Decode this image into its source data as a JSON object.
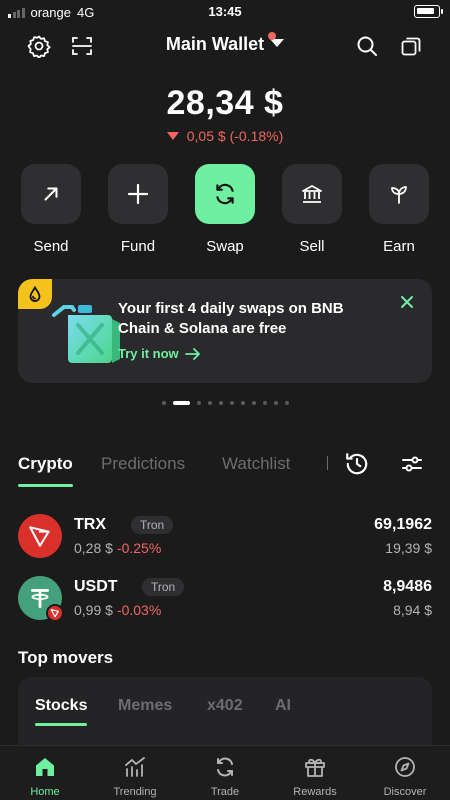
{
  "status_bar": {
    "carrier": "orange",
    "network": "4G",
    "time": "13:45"
  },
  "header": {
    "title": "Main Wallet"
  },
  "balance": {
    "amount": "28,34 $",
    "change": "0,05 $ (-0.18%)"
  },
  "actions": [
    {
      "label": "Send",
      "icon": "arrow-up-right-icon"
    },
    {
      "label": "Fund",
      "icon": "plus-icon"
    },
    {
      "label": "Swap",
      "icon": "swap-icon"
    },
    {
      "label": "Sell",
      "icon": "bank-icon"
    },
    {
      "label": "Earn",
      "icon": "sprout-icon"
    }
  ],
  "promo": {
    "text": "Your first 4 daily swaps on BNB Chain & Solana are free",
    "link": "Try it now"
  },
  "pager": {
    "total": 11,
    "active_index": 1
  },
  "tabs": [
    "Crypto",
    "Predictions",
    "Watchlist"
  ],
  "assets": [
    {
      "symbol": "TRX",
      "chain": "Tron",
      "price": "0,28 $",
      "change": "-0.25%",
      "amount": "69,1962",
      "value": "19,39 $"
    },
    {
      "symbol": "USDT",
      "chain": "Tron",
      "price": "0,99 $",
      "change": "-0.03%",
      "amount": "8,9486",
      "value": "8,94 $"
    }
  ],
  "top_movers": {
    "title": "Top movers",
    "tabs": [
      "Stocks",
      "Memes",
      "x402",
      "AI"
    ]
  },
  "nav": [
    {
      "label": "Home",
      "active": true
    },
    {
      "label": "Trending"
    },
    {
      "label": "Trade"
    },
    {
      "label": "Rewards"
    },
    {
      "label": "Discover"
    }
  ],
  "colors": {
    "accent": "#6ff0a0",
    "negative": "#f0675f",
    "background": "#1b1b1c",
    "card": "#2a2a2c"
  }
}
